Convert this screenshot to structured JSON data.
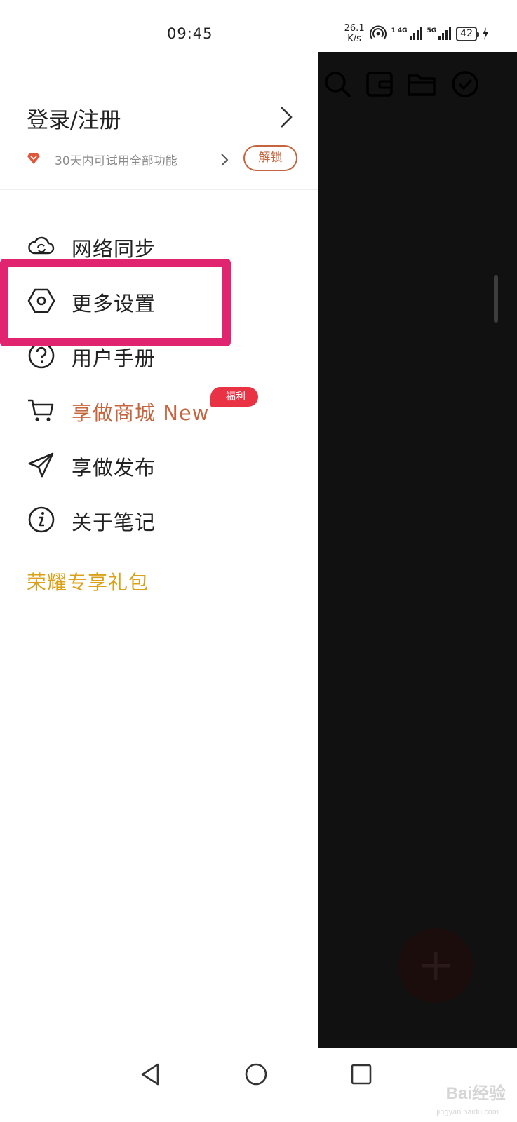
{
  "status_bar": {
    "time": "09:45",
    "net_speed_value": "26.1",
    "net_speed_unit": "K/s",
    "signal1_tag": "4G",
    "signal1_sim": "1",
    "signal2_tag": "5G",
    "battery": "42"
  },
  "drawer": {
    "login_title": "登录/注册",
    "trial_text": "30天内可试用全部功能",
    "unlock_label": "解锁",
    "menu": [
      {
        "label": "网络同步",
        "icon": "cloud-sync-icon"
      },
      {
        "label": "更多设置",
        "icon": "hexagon-settings-icon"
      },
      {
        "label": "用户手册",
        "icon": "question-circle-icon"
      },
      {
        "label": "享做商城 New",
        "icon": "cart-icon",
        "badge": "福利"
      },
      {
        "label": "享做发布",
        "icon": "paper-plane-icon"
      },
      {
        "label": "关于笔记",
        "icon": "info-circle-icon"
      }
    ],
    "gift_link": "荣耀专享礼包"
  },
  "colors": {
    "accent_orange": "#c6643e",
    "gift_gold": "#d9a018",
    "badge_red": "#e93344",
    "highlight_pink": "#e0246f",
    "overlay": "#111111"
  },
  "watermark": {
    "text": "Bai经验",
    "sub": "jingyan.baidu.com"
  }
}
